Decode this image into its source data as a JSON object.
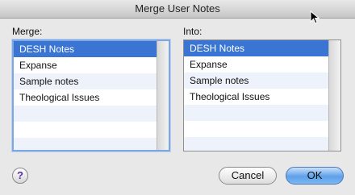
{
  "window": {
    "title": "Merge User Notes"
  },
  "merge": {
    "label": "Merge:",
    "items": [
      {
        "label": "DESH Notes",
        "selected": true
      },
      {
        "label": "Expanse",
        "selected": false
      },
      {
        "label": "Sample notes",
        "selected": false
      },
      {
        "label": "Theological Issues",
        "selected": false
      }
    ]
  },
  "into": {
    "label": "Into:",
    "items": [
      {
        "label": "DESH Notes",
        "selected": true
      },
      {
        "label": "Expanse",
        "selected": false
      },
      {
        "label": "Sample notes",
        "selected": false
      },
      {
        "label": "Theological Issues",
        "selected": false
      }
    ]
  },
  "buttons": {
    "help_label": "?",
    "cancel_label": "Cancel",
    "ok_label": "OK"
  },
  "icons": {
    "help": "help-icon",
    "cursor": "mouse-pointer-icon"
  },
  "colors": {
    "selection": "#3a75d3",
    "focus_ring": "#7ea6e0",
    "default_button": "#5fa0ea"
  }
}
